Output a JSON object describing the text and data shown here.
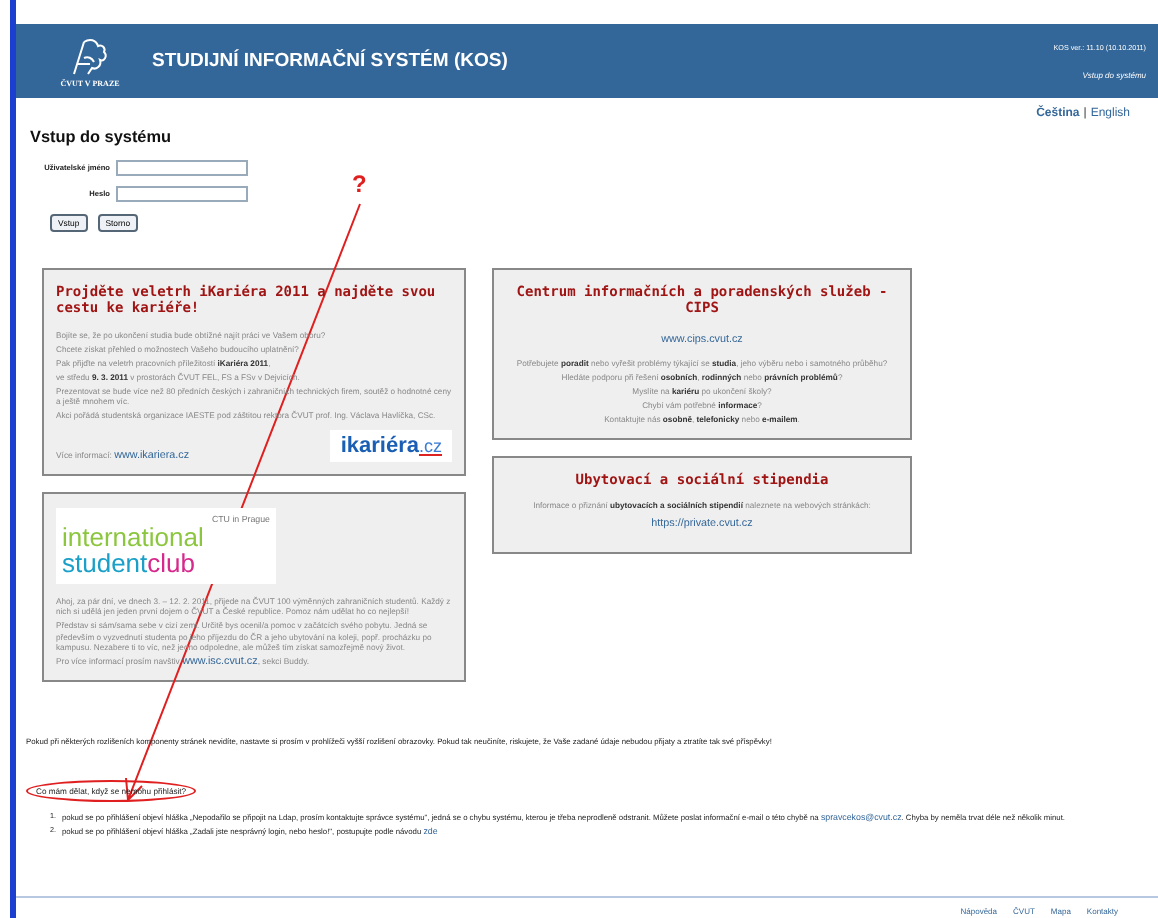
{
  "header": {
    "logo_caption": "ČVUT V PRAZE",
    "title": "STUDIJNÍ INFORMAČNÍ SYSTÉM (KOS)",
    "version": "KOS ver.: 11.10 (10.10.2011)",
    "location": "Vstup do systému"
  },
  "languages": [
    {
      "label": "Čeština",
      "selected": true
    },
    {
      "label": "English",
      "selected": false
    }
  ],
  "language_separator": "|",
  "login": {
    "heading": "Vstup do systému",
    "fields": [
      {
        "label": "Uživatelské jméno"
      },
      {
        "label": "Heslo"
      }
    ],
    "buttons": [
      "Vstup",
      "Storno"
    ]
  },
  "cards": [
    {
      "kind": "ikariera",
      "title": "Projděte veletrh iKariéra 2011 a najděte svou cestu ke kariéře!",
      "paragraphs": [
        "Bojíte se, že po ukončení studia bude obtížné najít práci ve Vašem oboru?",
        "Chcete získat přehled o možnostech Vašeho budoucího uplatnění?",
        "Pak přijďte na veletrh pracovních příležitostí **iKariéra 2011**,",
        "ve středu **9. 3. 2011** v prostorách ČVUT FEL, FS a FSv v Dejvicích.",
        "Prezentovat se bude více než 80 předních českých i zahraničních technických firem, soutěž o hodnotné ceny a ještě mnohem víc.",
        "Akci pořádá studentská organizace IAESTE pod záštitou rektora ČVUT prof. Ing. Václava Havlíčka, CSc."
      ],
      "more_label": "Více informací:",
      "link": "www.ikariera.cz",
      "logo_main": "ikariéra",
      "logo_suffix": ".cz"
    },
    {
      "kind": "isc",
      "logo_top": "CTU in Prague",
      "logo_line1": "international",
      "logo_line2a": "student",
      "logo_line2b": "club",
      "paragraphs": [
        "Ahoj, za pár dní, ve dnech 3. – 12. 2. 2011, přijede na ČVUT 100 výměnných zahraničních studentů. Každý z nich si udělá jen jeden první dojem o ČVUT a České republice. Pomoz nám udělat ho co nejlepší!",
        "Představ si sám/sama sebe v cizí zemi. Určitě bys ocenil/a pomoc v začátcích svého pobytu. Jedná se především o vyzvednutí studenta po jeho příjezdu do ČR a jeho ubytování na koleji, popř. procházku po kampusu. Nezabere ti to víc, než jedno odpoledne, ale můžeš tím získat samozřejmě nový život."
      ],
      "more_label": "Pro více informací prosím navštiv",
      "link": "www.isc.cvut.cz",
      "more_after": ", sekci Buddy."
    },
    {
      "kind": "cips",
      "title": "Centrum informačních a poradenských služeb - CIPS",
      "link": "www.cips.cvut.cz",
      "paragraphs": [
        "Potřebujete **poradit** nebo vyřešit problémy týkající se **studia**, jeho výběru nebo i samotného průběhu?",
        "Hledáte podporu při řešení **osobních**, **rodinných** nebo **právních problémů**?",
        "Myslíte na **kariéru** po ukončení školy?",
        "Chybí vám potřebné **informace**?",
        "Kontaktujte nás **osobně**, **telefonicky** nebo **e-mailem**."
      ]
    },
    {
      "kind": "stipendia",
      "title": "Ubytovací a sociální stipendia",
      "paragraphs": [
        "Informace o přiznání **ubytovacích a sociálních stipendií** naleznete na webových stránkách:"
      ],
      "link": "https://private.cvut.cz"
    }
  ],
  "notice": "Pokud při některých rozlišeních komponenty stránek nevidíte, nastavte si prosím v prohlížeči vyšší rozlišení obrazovky. Pokud tak neučiníte, riskujete, že Vaše zadané údaje nebudou přijaty a ztratíte tak své příspěvky!",
  "question": "Co mám dělat, když se nemohu přihlásit?",
  "annotation": {
    "mark": "?"
  },
  "answers": [
    {
      "number": "1.",
      "text": "pokud se po přihlášení objeví hláška „Nepodařilo se připojit na Ldap, prosím kontaktujte správce systému\", jedná se o chybu systému, kterou je třeba neprodleně odstranit. Můžete poslat informační e-mail o této chybě na",
      "link": "spravcekos@cvut.cz",
      "after": ". Chyba by neměla trvat déle než několik minut."
    },
    {
      "number": "2.",
      "text": "pokud se po přihlášení objeví hláška „Zadali jste nesprávný login, nebo heslo!\", postupujte podle návodu",
      "link": "zde"
    }
  ],
  "footer": [
    "Nápověda",
    "ČVUT",
    "Mapa",
    "Kontakty"
  ]
}
